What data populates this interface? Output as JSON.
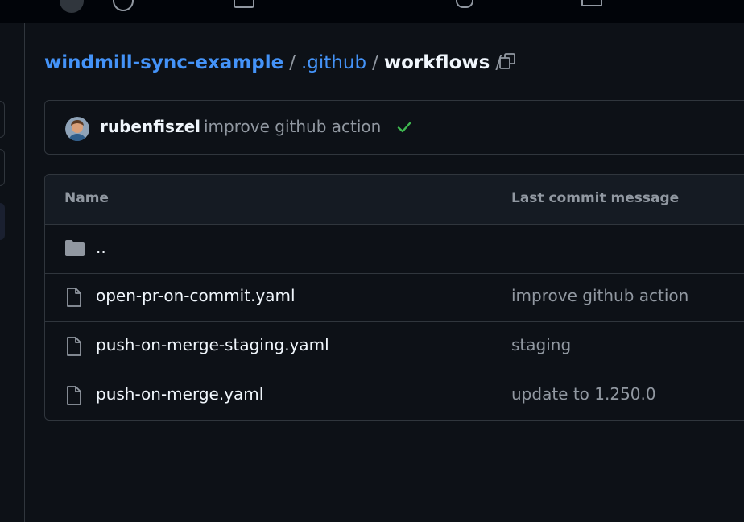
{
  "breadcrumb": {
    "repo": "windmill-sync-example",
    "folder": ".github",
    "current": "workflows",
    "sep": "/"
  },
  "commit": {
    "author": "rubenfiszel",
    "message": "improve github action",
    "status": "success",
    "status_color": "#3fb950"
  },
  "table": {
    "headers": {
      "name": "Name",
      "last_commit": "Last commit message"
    },
    "parent_dir": "..",
    "files": [
      {
        "name": "open-pr-on-commit.yaml",
        "message": "improve github action",
        "icon": "file-icon"
      },
      {
        "name": "push-on-merge-staging.yaml",
        "message": "staging",
        "icon": "file-icon"
      },
      {
        "name": "push-on-merge.yaml",
        "message": "update to 1.250.0",
        "icon": "file-icon"
      }
    ]
  },
  "colors": {
    "background": "#0d1117",
    "link": "#4493f8",
    "border": "#30363d",
    "muted": "#9198a1"
  }
}
